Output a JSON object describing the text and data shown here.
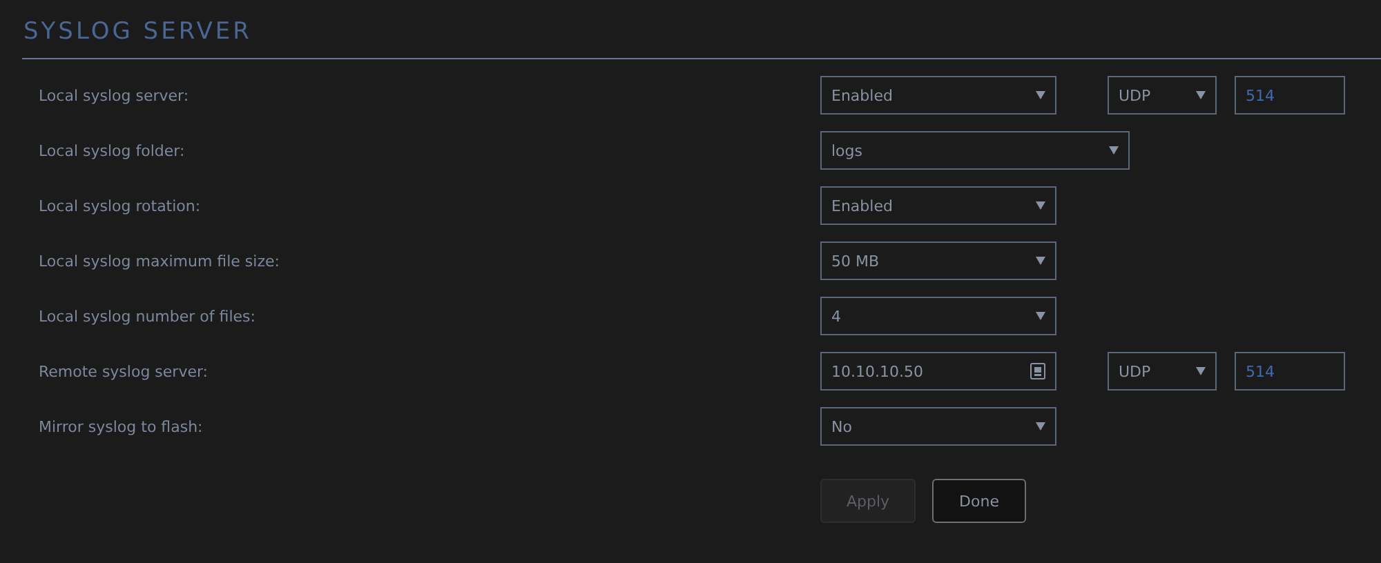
{
  "title": "SYSLOG SERVER",
  "rows": [
    {
      "label": "Local syslog server:",
      "controls": [
        {
          "kind": "select",
          "value": "Enabled"
        },
        {
          "kind": "protocol",
          "value": "UDP"
        },
        {
          "kind": "port",
          "value": "514"
        }
      ]
    },
    {
      "label": "Local syslog folder:",
      "controls": [
        {
          "kind": "wide-select",
          "value": "logs"
        }
      ]
    },
    {
      "label": "Local syslog rotation:",
      "controls": [
        {
          "kind": "select",
          "value": "Enabled"
        }
      ]
    },
    {
      "label": "Local syslog maximum file size:",
      "controls": [
        {
          "kind": "select",
          "value": "50 MB"
        }
      ]
    },
    {
      "label": "Local syslog number of files:",
      "controls": [
        {
          "kind": "select",
          "value": "4"
        }
      ]
    },
    {
      "label": "Remote syslog server:",
      "controls": [
        {
          "kind": "address",
          "value": "10.10.10.50"
        },
        {
          "kind": "protocol",
          "value": "UDP"
        },
        {
          "kind": "port",
          "value": "514"
        }
      ]
    },
    {
      "label": "Mirror syslog to flash:",
      "controls": [
        {
          "kind": "select",
          "value": "No"
        }
      ]
    }
  ],
  "buttons": [
    {
      "label": "Apply",
      "disabled": true
    },
    {
      "label": "Done",
      "disabled": false
    }
  ]
}
